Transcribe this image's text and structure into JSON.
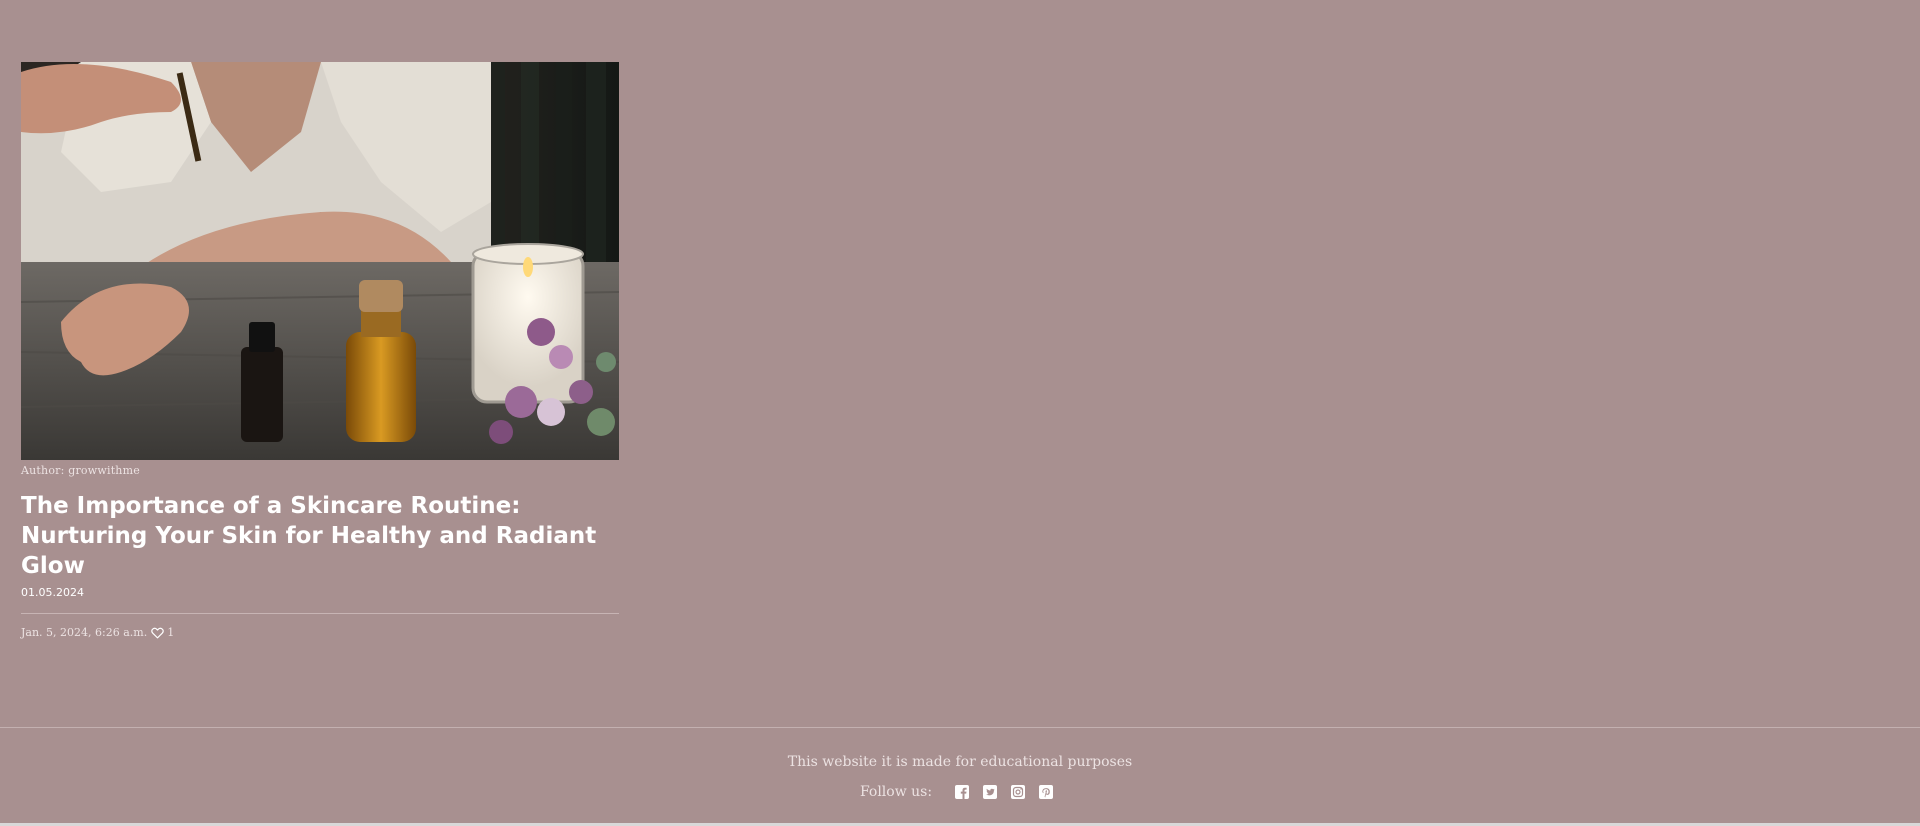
{
  "post": {
    "image_alt": "Skincare oils, dropper, candle and flowers on a wooden table",
    "author": "Author: growwithme",
    "title": "The Importance of a Skincare Routine: Nurturing Your Skin for Healthy and Radiant Glow",
    "date": "01.05.2024",
    "timestamp": "Jan. 5, 2024, 6:26 a.m.",
    "likes": "1",
    "like_icon": "heart-outline-icon"
  },
  "footer": {
    "note": "This website it is made for educational purposes",
    "follow_label": "Follow us:",
    "socials": [
      {
        "icon": "facebook-icon"
      },
      {
        "icon": "twitter-icon"
      },
      {
        "icon": "instagram-icon"
      },
      {
        "icon": "pinterest-icon"
      }
    ]
  },
  "colors": {
    "background": "#a89090",
    "text": "#ffffff",
    "muted_text": "#ece2e2"
  }
}
